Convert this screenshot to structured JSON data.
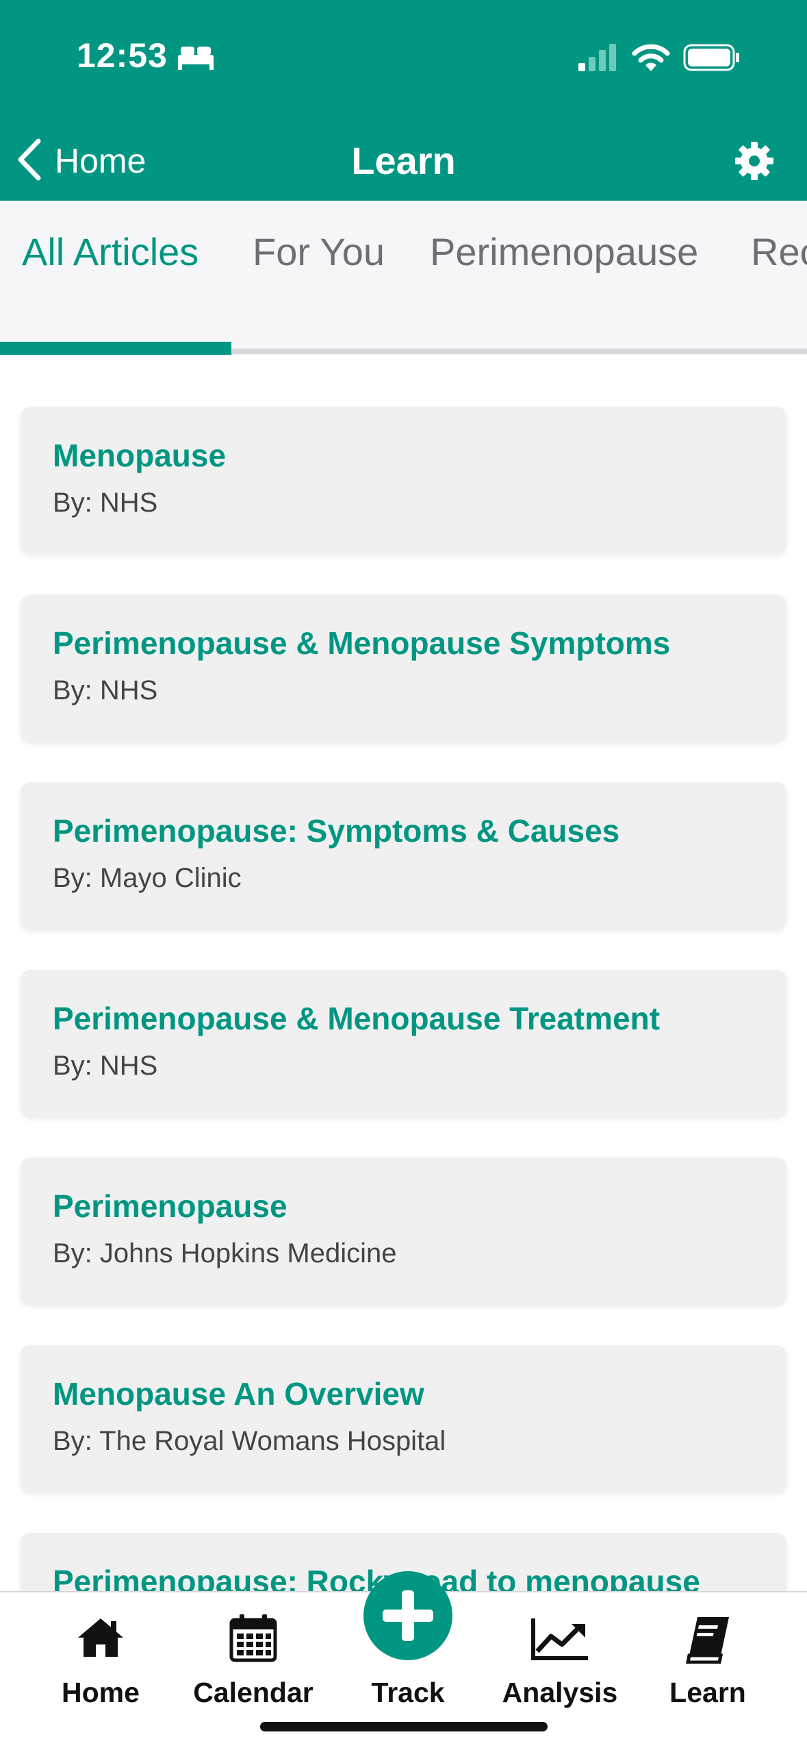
{
  "status_bar": {
    "time": "12:53"
  },
  "nav": {
    "back_label": "Home",
    "title": "Learn"
  },
  "tabs": [
    {
      "label": "All Articles",
      "active": true
    },
    {
      "label": "For You",
      "active": false
    },
    {
      "label": "Perimenopause",
      "active": false
    },
    {
      "label": "Rec",
      "active": false
    }
  ],
  "articles": [
    {
      "title": "Menopause",
      "by": "By: NHS"
    },
    {
      "title": "Perimenopause & Menopause Symptoms",
      "by": "By: NHS"
    },
    {
      "title": "Perimenopause: Symptoms & Causes",
      "by": "By: Mayo Clinic"
    },
    {
      "title": "Perimenopause & Menopause Treatment",
      "by": "By: NHS"
    },
    {
      "title": "Perimenopause",
      "by": "By: Johns Hopkins Medicine"
    },
    {
      "title": "Menopause An Overview",
      "by": "By: The Royal Womans Hospital"
    },
    {
      "title": "Perimenopause: Rocky road to menopause",
      "by": ""
    }
  ],
  "bottom_tabs": [
    {
      "label": "Home",
      "icon": "home-icon"
    },
    {
      "label": "Calendar",
      "icon": "calendar-icon"
    },
    {
      "label": "Track",
      "icon": "plus-circle-icon"
    },
    {
      "label": "Analysis",
      "icon": "chart-line-icon"
    },
    {
      "label": "Learn",
      "icon": "book-icon"
    }
  ],
  "colors": {
    "brand": "#009682",
    "tab_inactive": "#6e6e73",
    "card_bg": "#f0f0f0"
  }
}
